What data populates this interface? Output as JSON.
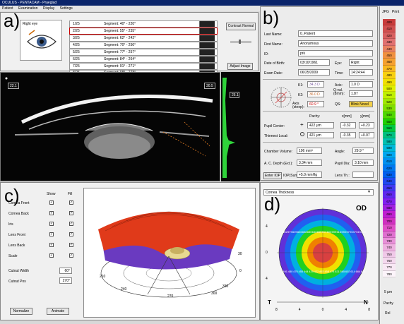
{
  "window": {
    "title": "OCULUS - PENTACAM - Praeglad"
  },
  "menu": [
    "Patient",
    "Examination",
    "Display",
    "Settings"
  ],
  "panel_letters": {
    "a": "a)",
    "b": "b)",
    "c": "c)",
    "d": "d)"
  },
  "eye": {
    "label": "Right eye"
  },
  "segments": [
    {
      "num": "1/25",
      "label": "Segment: 40° - 220°"
    },
    {
      "num": "2/25",
      "label": "Segment: 55° - 235°"
    },
    {
      "num": "3/25",
      "label": "Segment: 62° - 242°"
    },
    {
      "num": "4/25",
      "label": "Segment: 70° - 250°"
    },
    {
      "num": "5/25",
      "label": "Segment: 77° - 257°"
    },
    {
      "num": "6/25",
      "label": "Segment: 84° - 264°"
    },
    {
      "num": "7/25",
      "label": "Segment: 91° - 271°"
    },
    {
      "num": "8/25",
      "label": "Segment: 98° - 278°"
    }
  ],
  "buttons": {
    "contrast": "Contrast Normal",
    "adjust": "Adjust Image",
    "normalize": "Normalize",
    "animate": "Animate",
    "enter_iop": "Enter IOP"
  },
  "scheimpflug": {
    "left_readout": "22.1",
    "right_readout": "30.5",
    "side_value": "25.1"
  },
  "patient": {
    "last_name_label": "Last Name:",
    "last_name": "0_Patient",
    "first_name_label": "First Name:",
    "first_name": "Anonymous",
    "id_label": "ID:",
    "id": "prk",
    "dob_label": "Date of Birth:",
    "dob": "03/10/1961",
    "eye_label": "Eye:",
    "eye": "Right",
    "exam_date_label": "Exam Date:",
    "exam_date": "06/25/2009",
    "time_label": "Time:",
    "time": "14:24:44"
  },
  "keratometry": {
    "k1_label": "K1:",
    "k1": "34.3 D",
    "k2_label": "K2:",
    "k2": "36.0 D",
    "axis_label": "Axis:",
    "axis": "1.0 D",
    "qval_label": "Q-val. (8mm):",
    "qval": "1.87",
    "astig_label": "Axis (steep):",
    "astig": "60.9 °",
    "qs_label": "QS:",
    "qs": "Blink Novel"
  },
  "pupil": {
    "pachy_label": "Pachy:",
    "x_label": "x[mm]",
    "y_label": "y[mm]",
    "center_label": "Pupil Center:",
    "center_pachy": "422 μm",
    "center_x": "-0.32",
    "center_y": "+0.23",
    "thinnest_label": "Thinnest Local:",
    "thinnest_pachy": "421 μm",
    "thinnest_x": "-0.35",
    "thinnest_y": "+0.07"
  },
  "chamber": {
    "volume_label": "Chamber Volume:",
    "volume": "196 mm³",
    "angle_label": "Angle:",
    "angle": "29.9 °",
    "depth_label": "A. C. Depth (Ext.):",
    "depth": "3.34 mm",
    "pupil_dia_label": "Pupil Dia:",
    "pupil_dia": "3.10 mm",
    "iop_label": "IOP(Sum):",
    "iop": "+5.0 mmHg",
    "lens_label": "Lens Th.:",
    "lens": ""
  },
  "layers": {
    "show_label": "Show",
    "fill_label": "Fill",
    "items": [
      "Cornea Front",
      "Cornea Back",
      "Iris",
      "Lens Front",
      "Lens Back",
      "Scale"
    ],
    "cutout_width_label": "Cutout Width",
    "cutout_width": "60°",
    "cutout_pos_label": "Cutout Pos",
    "cutout_pos": "270°"
  },
  "view3d": {
    "angle_labels": [
      "300",
      "270",
      "240",
      "210",
      "330",
      "0",
      "30"
    ]
  },
  "thickness_map": {
    "dropdown": "Cornea Thickness",
    "eye": "OD",
    "temporal": "T",
    "nasal": "N",
    "x_ticks": [
      "8",
      "4",
      "0",
      "4",
      "8"
    ],
    "y_ticks": [
      "4",
      "0",
      "4"
    ],
    "values": [
      "562",
      "579",
      "609",
      "626",
      "638",
      "635",
      "648",
      "655",
      "614",
      "603",
      "599",
      "613",
      "590",
      "579",
      "537",
      "519",
      "505",
      "491",
      "480",
      "470",
      "455",
      "444",
      "429",
      "422",
      "463",
      "458",
      "478",
      "521",
      "565",
      "602",
      "614",
      "664",
      "634"
    ]
  },
  "color_scale": {
    "header": [
      "JPG",
      "Print"
    ],
    "values": [
      "400",
      "410",
      "420",
      "430",
      "440",
      "450",
      "460",
      "470",
      "480",
      "490",
      "500",
      "510",
      "520",
      "530",
      "540",
      "550",
      "560",
      "570",
      "580",
      "590",
      "600",
      "610",
      "620",
      "630",
      "640",
      "650",
      "660",
      "670",
      "680",
      "690",
      "700",
      "710",
      "720",
      "730",
      "740",
      "750",
      "760",
      "770",
      "780"
    ],
    "colors": [
      "#c83c3c",
      "#d05050",
      "#d86060",
      "#e07070",
      "#e88060",
      "#f09040",
      "#f4a030",
      "#f8b820",
      "#f8d010",
      "#f0e000",
      "#e0f000",
      "#c0f000",
      "#a0e800",
      "#80e000",
      "#50d800",
      "#20d000",
      "#00c840",
      "#00c080",
      "#00c0b0",
      "#00b8d8",
      "#00a8f0",
      "#0090f0",
      "#0078f0",
      "#0060f0",
      "#2048f0",
      "#4038f0",
      "#6028f0",
      "#8020f0",
      "#a020e0",
      "#c020d0",
      "#d030c0",
      "#e050c8",
      "#e070d0",
      "#e890d8",
      "#eeb0e0",
      "#f0c8e8",
      "#f4d8ee",
      "#f8e8f4",
      "#fcf4fa"
    ],
    "footer": [
      "5 μm",
      "Pachy",
      "Rel"
    ]
  }
}
